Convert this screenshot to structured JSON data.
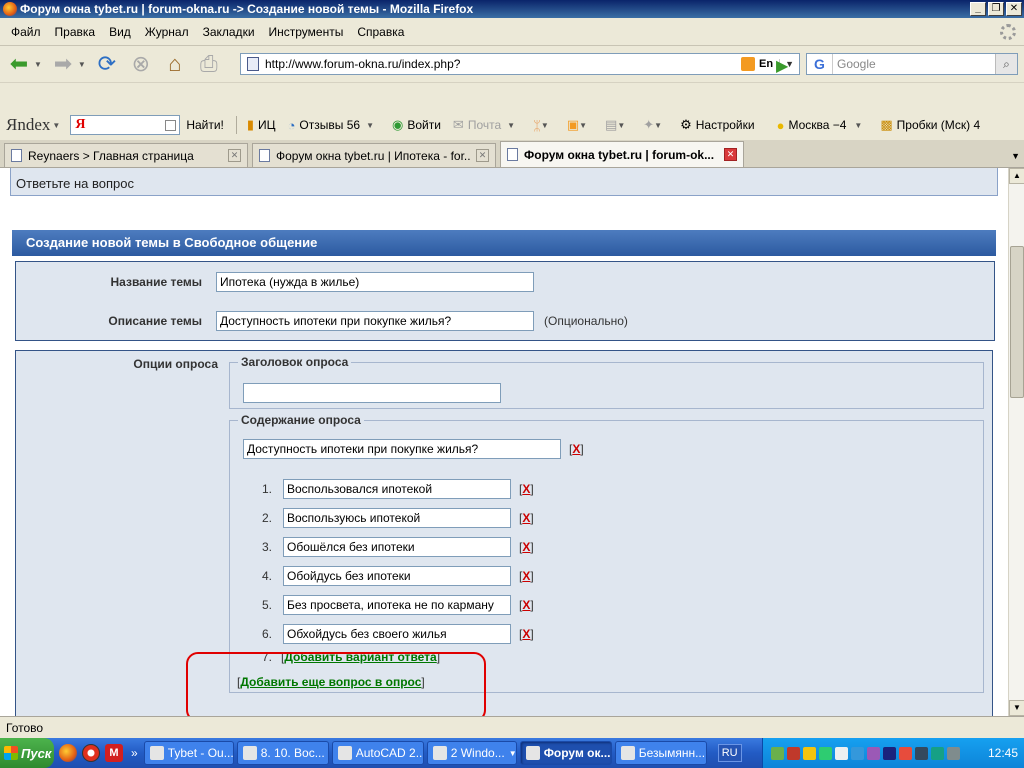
{
  "window": {
    "title": "Форум окна tybet.ru | forum-okna.ru -> Создание новой темы - Mozilla Firefox"
  },
  "menu": [
    "Файл",
    "Правка",
    "Вид",
    "Журнал",
    "Закладки",
    "Инструменты",
    "Справка"
  ],
  "navigation": {
    "url": "http://www.forum-okna.ru/index.php?",
    "lang_indicator": "En",
    "search_placeholder": "Google",
    "search_engine_letter": "G"
  },
  "yandex_toolbar": {
    "logo": "Яndex",
    "field_letter": "Я",
    "find": "Найти!",
    "ic": "ИЦ",
    "reviews": "Отзывы 56",
    "login": "Войти",
    "mail": "Почта",
    "settings": "Настройки",
    "weather": "Москва −4",
    "traffic": "Пробки (Мск) 4"
  },
  "tabs": [
    {
      "label": "Reynaers > Главная страница",
      "active": false
    },
    {
      "label": "Форум окна tybet.ru | Ипотека - for...",
      "active": false
    },
    {
      "label": "Форум окна tybet.ru | forum-ok...",
      "active": true
    }
  ],
  "page": {
    "answer_bar": "Ответьте на вопрос",
    "panel_title": "Создание новой темы в Свободное общение",
    "topic_title_label": "Название темы",
    "topic_title_value": "Ипотека (нужда в жилье)",
    "topic_desc_label": "Описание темы",
    "topic_desc_value": "Доступность ипотеки при покупке жилья?",
    "optional_note": "(Опционально)",
    "poll_options_label": "Опции опроса",
    "poll_title_legend": "Заголовок опроса",
    "poll_title_value": "",
    "poll_content_legend": "Содержание опроса",
    "question_value": "Доступность ипотеки при покупке жилья?",
    "remove_label": "X",
    "choices": [
      {
        "num": "1.",
        "text": "Воспользовался ипотекой"
      },
      {
        "num": "2.",
        "text": "Воспользуюсь ипотекой"
      },
      {
        "num": "3.",
        "text": "Обошёлся без ипотеки"
      },
      {
        "num": "4.",
        "text": "Обойдусь без ипотеки"
      },
      {
        "num": "5.",
        "text": "Без просвета, ипотека не по карману"
      },
      {
        "num": "6.",
        "text": "Обхойдусь без своего жилья"
      }
    ],
    "add_choice_num": "7.",
    "add_choice_link": "Добавить вариант ответа",
    "add_question_link": "Добавить еще вопрос в опрос"
  },
  "status": {
    "text": "Готово"
  },
  "taskbar": {
    "start": "Пуск",
    "tasks": [
      {
        "label": "Tybet - Ou...",
        "active": false
      },
      {
        "label": "8. 10. Вос...",
        "active": false
      },
      {
        "label": "AutoCAD 2...",
        "active": false
      },
      {
        "label": "2 Windo...",
        "active": false
      },
      {
        "label": "Форум ок...",
        "active": true
      },
      {
        "label": "Безымянн...",
        "active": false
      }
    ],
    "language": "RU",
    "clock": "12:45"
  },
  "colors": {
    "panel_header": "#2c5aa0",
    "form_background": "#dfe6ef",
    "link_green": "#007700",
    "remove_red": "#cc0000",
    "highlight_red": "#e00000"
  }
}
